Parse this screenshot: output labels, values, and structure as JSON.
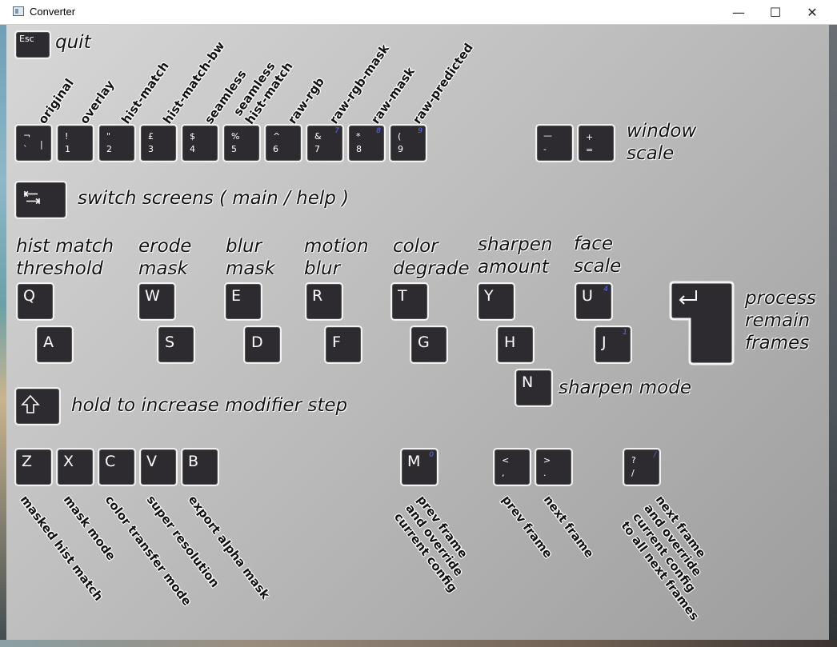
{
  "window": {
    "title": "Converter",
    "minimize": "—",
    "maximize": "☐",
    "close": "✕"
  },
  "quit": {
    "key": "Esc",
    "label": "quit"
  },
  "modes": [
    {
      "label": "original",
      "top": "¬",
      "bottom": "`",
      "right": "|"
    },
    {
      "label": "overlay",
      "top": "!",
      "bottom": "1"
    },
    {
      "label": "hist-match",
      "top": "\"",
      "bottom": "2"
    },
    {
      "label": "hist-match-bw",
      "top": "£",
      "bottom": "3"
    },
    {
      "label": "seamless",
      "top": "$",
      "bottom": "4"
    },
    {
      "label": "seamless\nhist-match",
      "top": "%",
      "bottom": "5"
    },
    {
      "label": "raw-rgb",
      "top": "^",
      "bottom": "6"
    },
    {
      "label": "raw-rgb-mask",
      "top": "&",
      "bottom": "7",
      "num": "7"
    },
    {
      "label": "raw-mask",
      "top": "*",
      "bottom": "8",
      "num": "8"
    },
    {
      "label": "raw-predicted",
      "top": "(",
      "bottom": "9",
      "num": "9"
    }
  ],
  "window_scale": {
    "label": "window\nscale",
    "minus_top": "—",
    "minus_bottom": "-",
    "plus_top": "+",
    "plus_bottom": "="
  },
  "switch_screens": {
    "label": "switch screens ( main / help )"
  },
  "params": [
    {
      "label": "hist match\nthreshold",
      "up": "Q",
      "down": "A"
    },
    {
      "label": "erode\nmask",
      "up": "W",
      "down": "S"
    },
    {
      "label": "blur\nmask",
      "up": "E",
      "down": "D"
    },
    {
      "label": "motion\nblur",
      "up": "R",
      "down": "F"
    },
    {
      "label": "color\ndegrade",
      "up": "T",
      "down": "G"
    },
    {
      "label": "sharpen\namount",
      "up": "Y",
      "down": "H"
    },
    {
      "label": "face\nscale",
      "up": "U",
      "down": "J",
      "up_num": "4",
      "down_num": "1"
    }
  ],
  "sharpen_mode": {
    "key": "N",
    "label": "sharpen mode"
  },
  "process": {
    "label": "process\nremain\nframes"
  },
  "modifier": {
    "label": "hold to increase modifier step"
  },
  "toggles": [
    {
      "key": "Z",
      "label": "masked hist match"
    },
    {
      "key": "X",
      "label": "mask mode"
    },
    {
      "key": "C",
      "label": "color transfer mode"
    },
    {
      "key": "V",
      "label": "super resolution"
    },
    {
      "key": "B",
      "label": "export alpha mask"
    }
  ],
  "m_key": {
    "key": "M",
    "num": "0",
    "label": "prev frame\nand override\ncurrent config"
  },
  "prev_frame": {
    "top": "<",
    "bottom": ",",
    "label": "prev frame"
  },
  "next_frame": {
    "top": ">",
    "bottom": ".",
    "label": "next frame"
  },
  "next_override": {
    "top": "?",
    "bottom": "/",
    "num": "/",
    "label": "next frame\nand override\ncurrent config\nto all next frames"
  },
  "colors": {
    "key_bg": "#2e2b30",
    "key_border": "#f2f2f2",
    "num_blue": "#5b6cff",
    "label_text": "#111111"
  }
}
